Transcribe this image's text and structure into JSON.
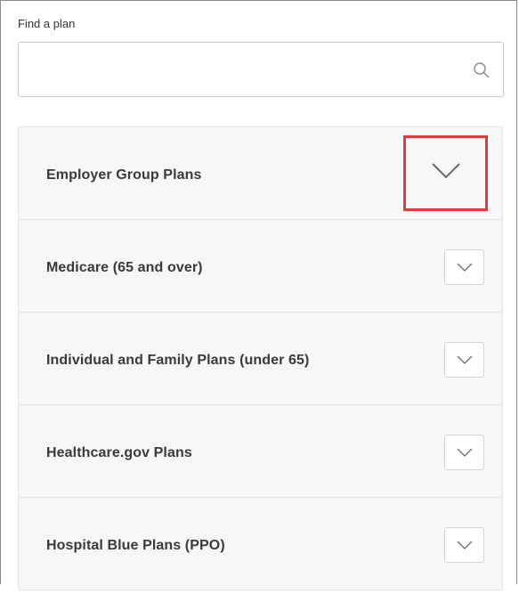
{
  "search": {
    "label": "Find a plan",
    "value": "",
    "placeholder": "",
    "icon": "search-icon"
  },
  "plans": [
    {
      "label": "Employer Group Plans",
      "expanded": false,
      "highlighted": true
    },
    {
      "label": "Medicare (65 and over)",
      "expanded": false,
      "highlighted": false
    },
    {
      "label": "Individual and Family Plans (under 65)",
      "expanded": false,
      "highlighted": false
    },
    {
      "label": "Healthcare.gov Plans",
      "expanded": false,
      "highlighted": false
    },
    {
      "label": "Hospital Blue Plans (PPO)",
      "expanded": false,
      "highlighted": false
    }
  ],
  "colors": {
    "highlight": "#e23b3b",
    "row_background": "#f7f7f7",
    "text": "#3a3a3a"
  }
}
